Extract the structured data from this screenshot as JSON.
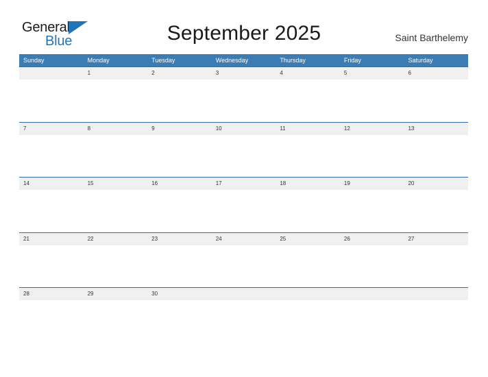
{
  "brand": {
    "name_part1": "General",
    "name_part2": "Blue",
    "triangle_icon": "blue-triangle-icon",
    "color_dark": "#1a1a1a",
    "color_blue": "#2274b5"
  },
  "header": {
    "title": "September 2025",
    "location": "Saint Barthelemy"
  },
  "calendar": {
    "month": "September",
    "year": "2025",
    "accent_header_color": "#3b7cb5",
    "row_divider_color": "#2e6da4",
    "day_band_color": "#f0f0f0",
    "weekdays": [
      "Sunday",
      "Monday",
      "Tuesday",
      "Wednesday",
      "Thursday",
      "Friday",
      "Saturday"
    ],
    "weeks": [
      [
        "",
        "1",
        "2",
        "3",
        "4",
        "5",
        "6"
      ],
      [
        "7",
        "8",
        "9",
        "10",
        "11",
        "12",
        "13"
      ],
      [
        "14",
        "15",
        "16",
        "17",
        "18",
        "19",
        "20"
      ],
      [
        "21",
        "22",
        "23",
        "24",
        "25",
        "26",
        "27"
      ],
      [
        "28",
        "29",
        "30",
        "",
        "",
        "",
        ""
      ]
    ]
  }
}
